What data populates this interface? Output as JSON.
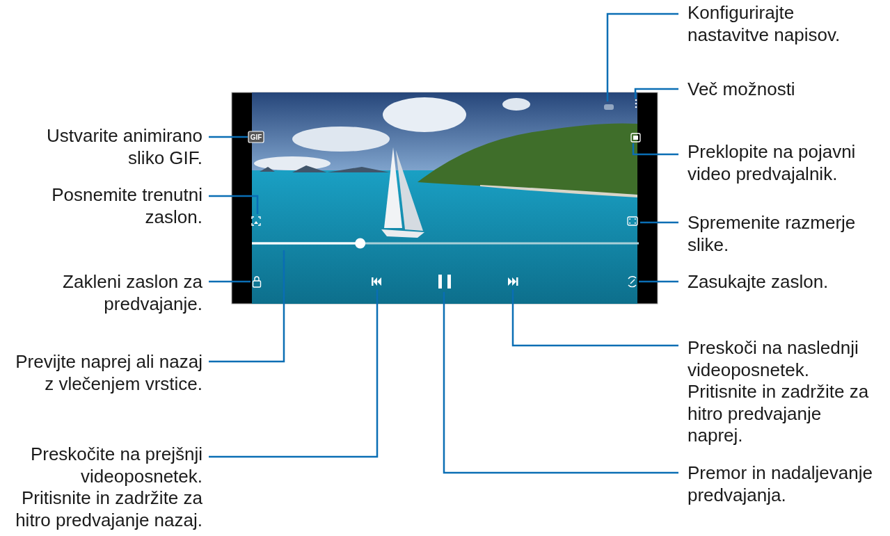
{
  "player": {
    "gif_icon_text": "GIF",
    "playing": true,
    "progress": {
      "level": 0.28
    }
  },
  "callouts": [
    {
      "kind": "left",
      "text": "Ustvarite animirano\nsliko GIF."
    },
    {
      "kind": "left",
      "text": "Posnemite trenutni\nzaslon."
    },
    {
      "kind": "left",
      "text": "Zakleni zaslon za\npredvajanje."
    },
    {
      "kind": "left",
      "text": "Previjte naprej ali nazaj\nz vlečenjem vrstice."
    },
    {
      "kind": "left",
      "text": "Preskočite na prejšnji\nvideoposnetek.\nPritisnite in zadržite za\nhitro predvajanje nazaj."
    },
    {
      "kind": "right",
      "text": "Konfigurirajte\nnastavitve napisov."
    },
    {
      "kind": "right",
      "text": "Več možnosti"
    },
    {
      "kind": "right",
      "text": "Preklopite na pojavni\nvideo predvajalnik."
    },
    {
      "kind": "right",
      "text": "Spremenite razmerje\nslike."
    },
    {
      "kind": "right",
      "text": "Zasukajte zaslon."
    },
    {
      "kind": "right",
      "text": "Preskoči na naslednji\nvideoposnetek.\nPritisnite in zadržite za\nhitro predvajanje\nnaprej."
    },
    {
      "kind": "right",
      "text": "Premor in nadaljevanje\npredvajanja."
    }
  ]
}
